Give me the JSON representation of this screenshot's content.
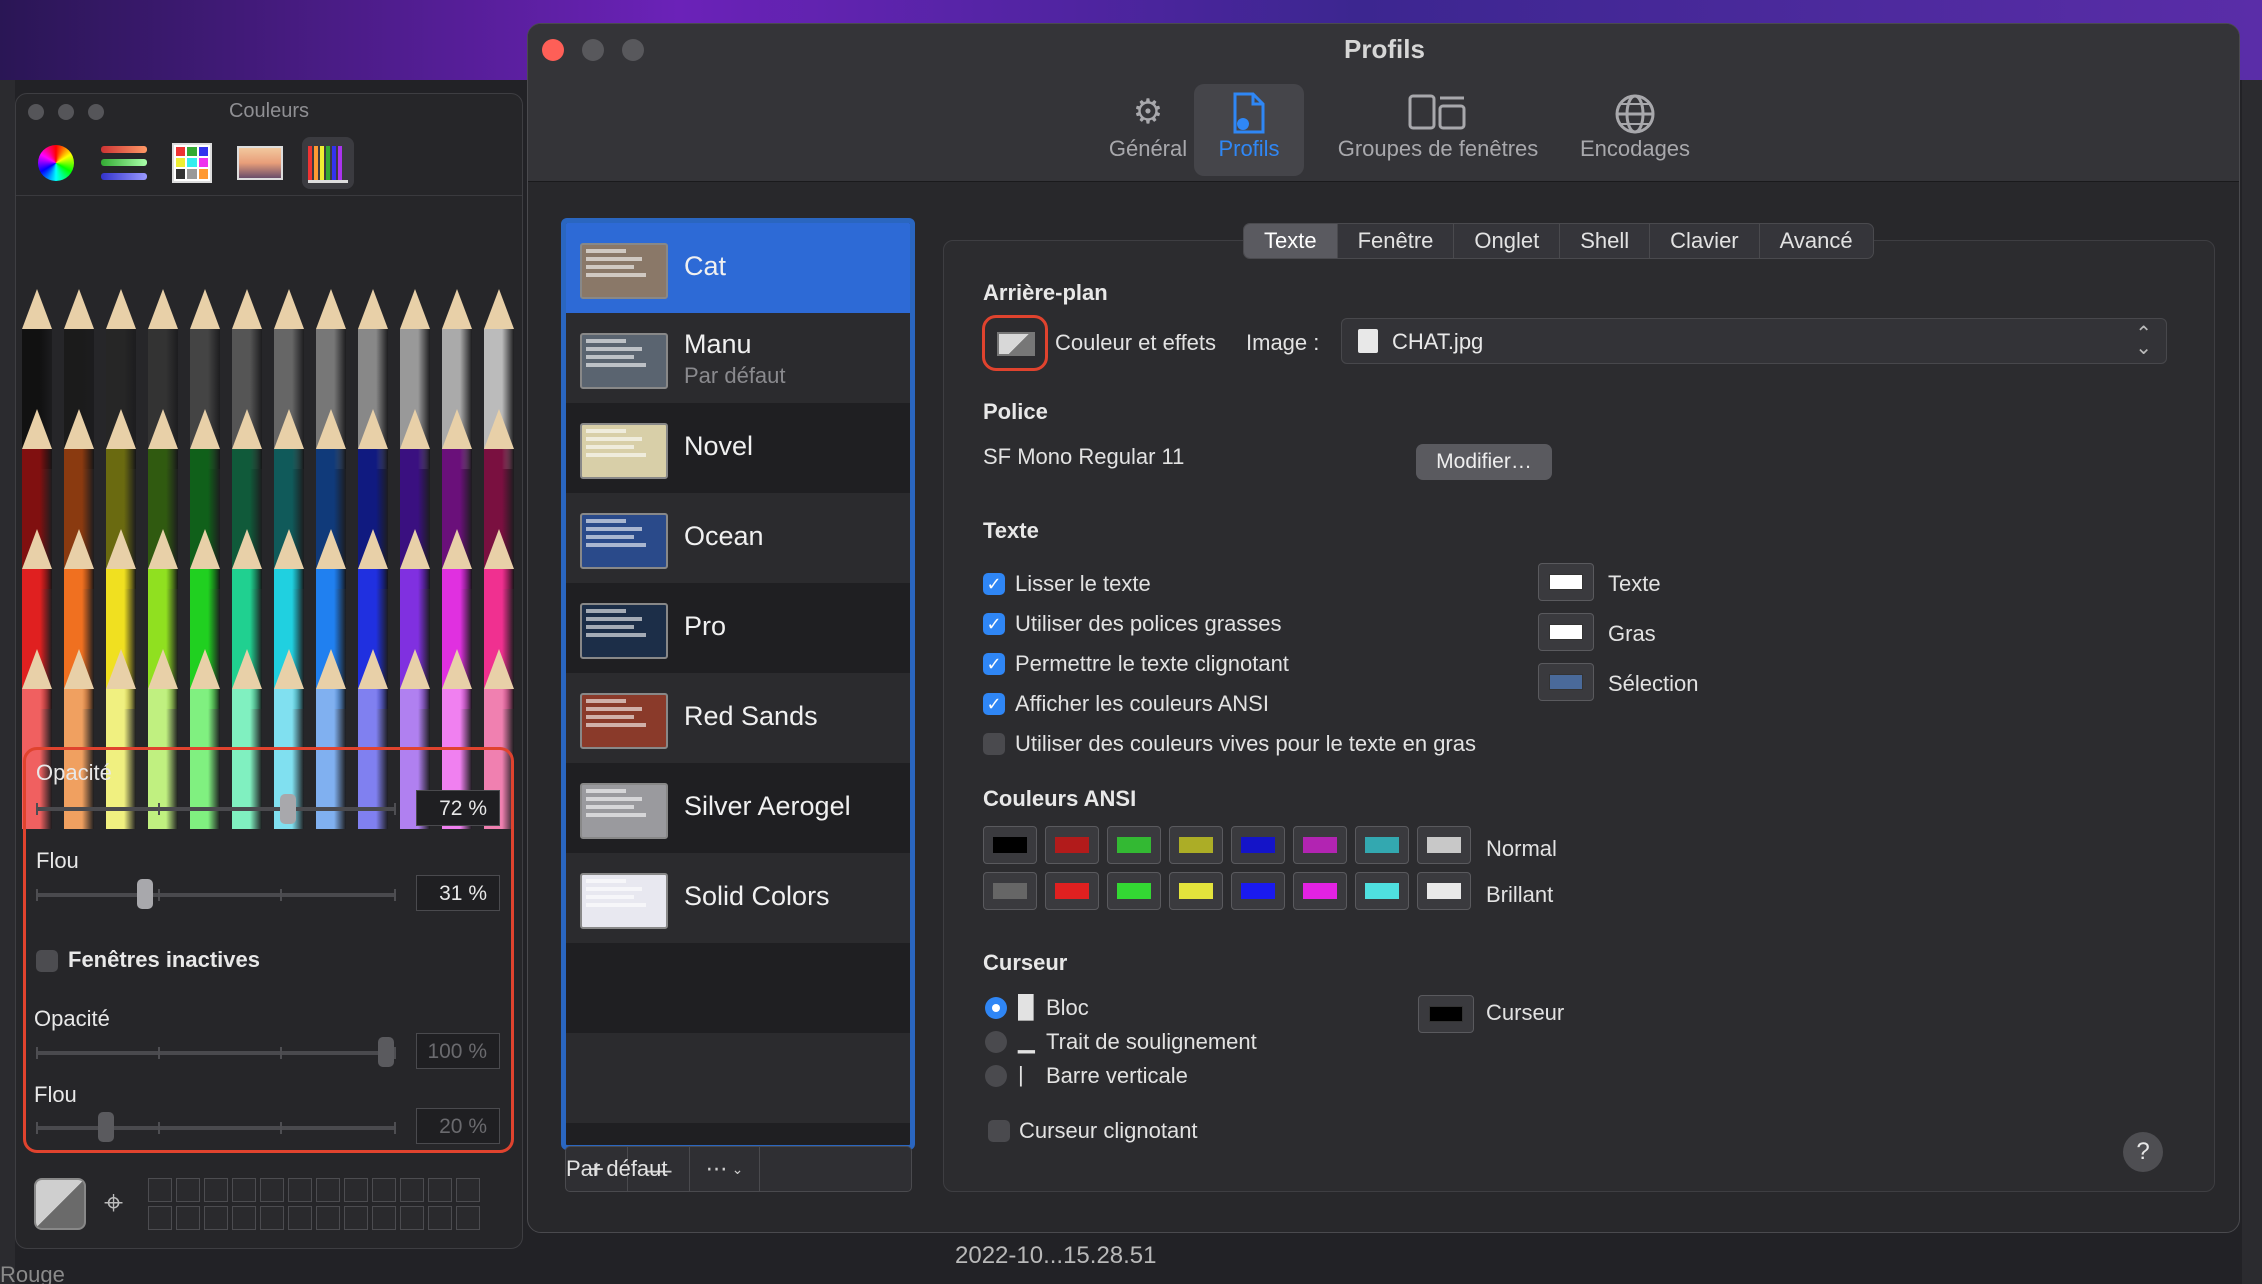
{
  "desktop": {
    "bottom_file": "2022-10...15.28.51",
    "bottom_left": "Rouge"
  },
  "colors_window": {
    "title": "Couleurs",
    "modes": [
      "color-wheel-icon",
      "color-sliders-icon",
      "color-palettes-icon",
      "image-palettes-icon",
      "crayons-icon"
    ],
    "active_mode": "crayons",
    "opacity_label": "Opacité",
    "opacity_value": "72 %",
    "opacity_level": 0.72,
    "blur_label": "Flou",
    "blur_value": "31 %",
    "blur_level": 0.31,
    "inactive_label": "Fenêtres inactives",
    "inactive_checked": false,
    "inactive_opacity_label": "Opacité",
    "inactive_opacity_value": "100 %",
    "inactive_opacity_level": 1.0,
    "inactive_blur_label": "Flou",
    "inactive_blur_value": "20 %",
    "inactive_blur_level": 0.2
  },
  "profiles_window": {
    "title": "Profils",
    "toolbar": [
      {
        "label": "Général",
        "icon": "gear-icon"
      },
      {
        "label": "Profils",
        "icon": "profile-document-icon",
        "selected": true
      },
      {
        "label": "Groupes de fenêtres",
        "icon": "window-groups-icon"
      },
      {
        "label": "Encodages",
        "icon": "globe-icon"
      }
    ],
    "profiles": [
      {
        "name": "Cat",
        "selected": true,
        "thumb": "#8a7868"
      },
      {
        "name": "Manu",
        "sub": "Par défaut",
        "thumb": "#5a6470"
      },
      {
        "name": "Novel",
        "thumb": "#d8cfa8"
      },
      {
        "name": "Ocean",
        "thumb": "#2a4a8a"
      },
      {
        "name": "Pro",
        "thumb": "#1c2e48"
      },
      {
        "name": "Red Sands",
        "thumb": "#8a3a2a"
      },
      {
        "name": "Silver Aerogel",
        "thumb": "#9a9a9e"
      },
      {
        "name": "Solid Colors",
        "thumb": "#e8e8f0"
      }
    ],
    "list_buttons": {
      "add": "+",
      "remove": "—",
      "more": "⋯",
      "default": "Par défaut"
    },
    "tabs": [
      "Texte",
      "Fenêtre",
      "Onglet",
      "Shell",
      "Clavier",
      "Avancé"
    ],
    "active_tab": "Texte",
    "background": {
      "heading": "Arrière-plan",
      "color_label": "Couleur et effets",
      "image_label": "Image :",
      "image_value": "CHAT.jpg"
    },
    "font": {
      "heading": "Police",
      "value": "SF Mono Regular 11",
      "button": "Modifier…"
    },
    "text": {
      "heading": "Texte",
      "options": [
        {
          "label": "Lisser le texte",
          "checked": true
        },
        {
          "label": "Utiliser des polices grasses",
          "checked": true
        },
        {
          "label": "Permettre le texte clignotant",
          "checked": true
        },
        {
          "label": "Afficher les couleurs ANSI",
          "checked": true
        },
        {
          "label": "Utiliser des couleurs vives pour le texte en gras",
          "checked": false
        }
      ],
      "wells": [
        {
          "label": "Texte",
          "color": "#ffffff"
        },
        {
          "label": "Gras",
          "color": "#ffffff"
        },
        {
          "label": "Sélection",
          "color": "#4a6a9a"
        }
      ]
    },
    "ansi": {
      "heading": "Couleurs ANSI",
      "normal_label": "Normal",
      "bright_label": "Brillant",
      "normal": [
        "#000000",
        "#b21b1b",
        "#33b933",
        "#acad26",
        "#1414c8",
        "#b224b2",
        "#33a8b0",
        "#c8c8c8"
      ],
      "bright": [
        "#666666",
        "#e02020",
        "#33d833",
        "#e4e43c",
        "#1a1aef",
        "#e222e2",
        "#4fe0e0",
        "#e8e8e8"
      ]
    },
    "cursor": {
      "heading": "Curseur",
      "options": [
        {
          "label": "Bloc",
          "glyph": "█",
          "selected": true
        },
        {
          "label": "Trait de soulignement",
          "glyph": "▁",
          "selected": false
        },
        {
          "label": "Barre verticale",
          "glyph": "|",
          "selected": false
        }
      ],
      "blink_label": "Curseur clignotant",
      "blink_checked": false,
      "well_label": "Curseur",
      "well_color": "#000000"
    },
    "help": "?"
  }
}
